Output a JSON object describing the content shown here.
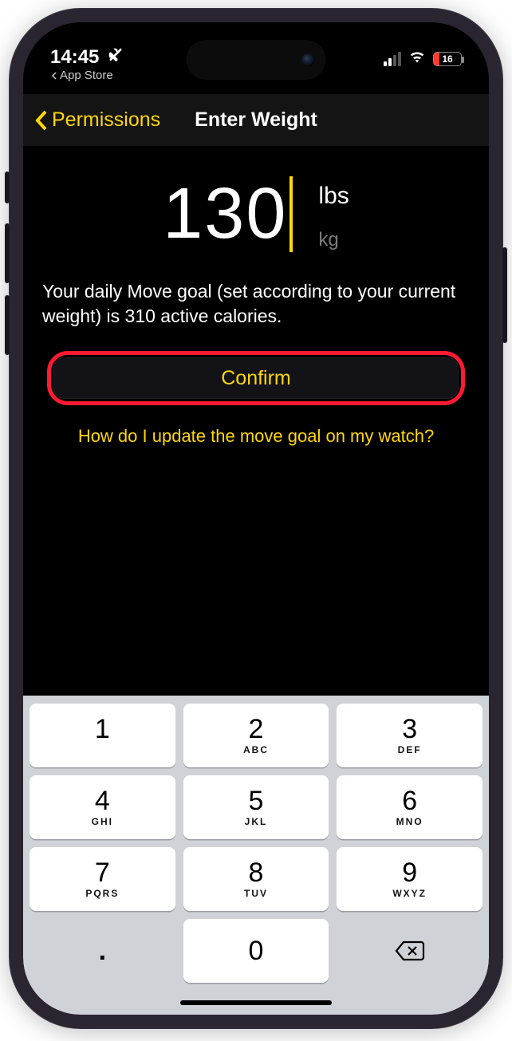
{
  "status": {
    "time": "14:45",
    "backApp": "App Store",
    "battery": "16"
  },
  "nav": {
    "back_label": "Permissions",
    "title": "Enter Weight"
  },
  "weight": {
    "value": "130",
    "unit_lbs": "lbs",
    "unit_kg": "kg"
  },
  "description": "Your daily Move goal (set according to your current weight) is 310 active calories.",
  "buttons": {
    "confirm": "Confirm",
    "help_link": "How do I update the move goal on my watch?"
  },
  "keypad": {
    "keys": [
      {
        "d": "1",
        "l": ""
      },
      {
        "d": "2",
        "l": "ABC"
      },
      {
        "d": "3",
        "l": "DEF"
      },
      {
        "d": "4",
        "l": "GHI"
      },
      {
        "d": "5",
        "l": "JKL"
      },
      {
        "d": "6",
        "l": "MNO"
      },
      {
        "d": "7",
        "l": "PQRS"
      },
      {
        "d": "8",
        "l": "TUV"
      },
      {
        "d": "9",
        "l": "WXYZ"
      }
    ],
    "dot": ".",
    "zero": "0"
  }
}
